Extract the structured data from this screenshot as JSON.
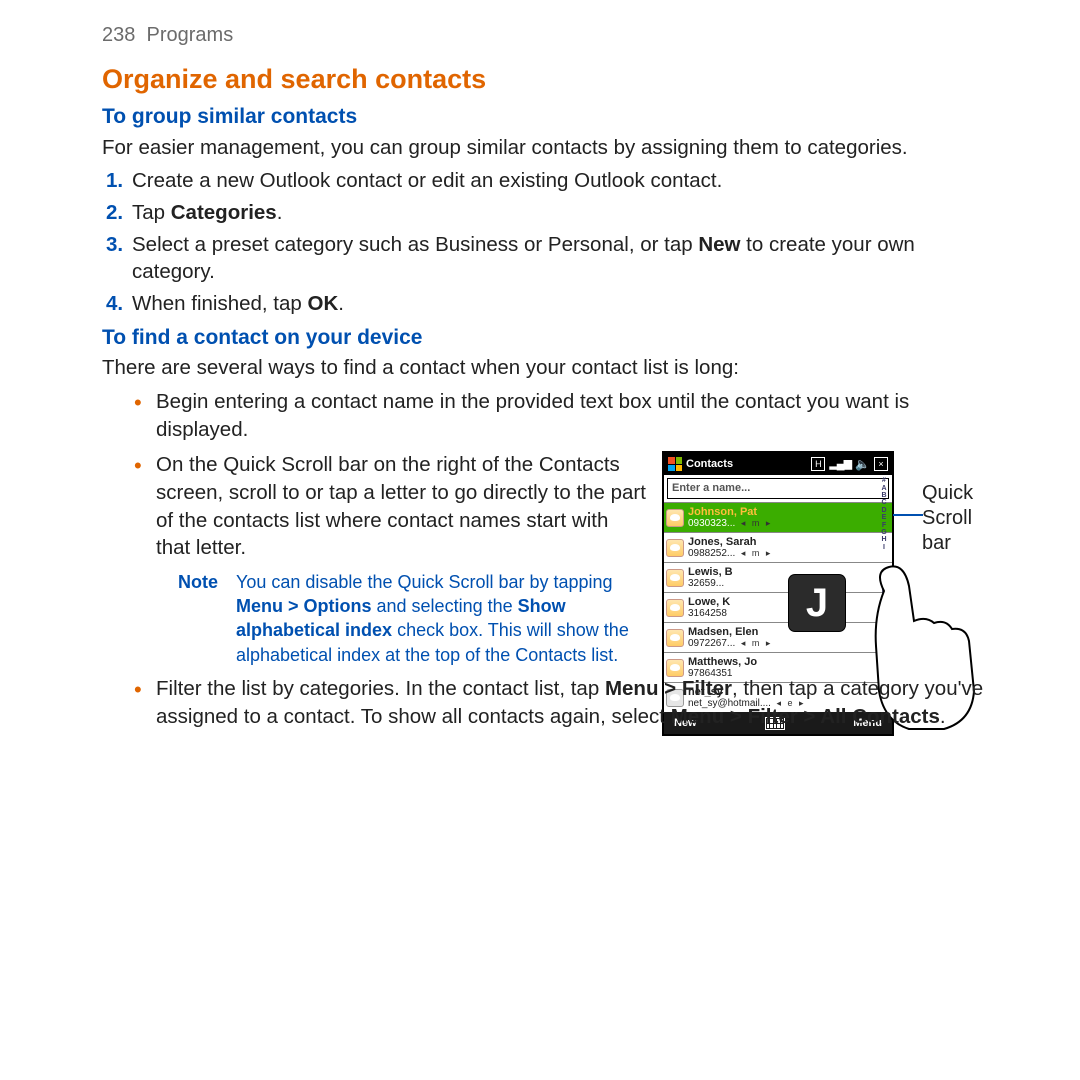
{
  "header": {
    "page_num": "238",
    "section": "Programs"
  },
  "title": "Organize and search contacts",
  "sub1": "To group similar contacts",
  "para1": "For easier management, you can group similar contacts by assigning them to categories.",
  "steps": [
    "Create a new Outlook contact or edit an existing Outlook contact.",
    {
      "pre": "Tap ",
      "b": "Categories",
      "post": "."
    },
    {
      "pre": "Select a preset category such as Business or Personal, or tap ",
      "b": "New",
      "post": " to create your own category."
    },
    {
      "pre": "When finished, tap ",
      "b": "OK",
      "post": "."
    }
  ],
  "sub2": "To find a contact on your device",
  "para2": "There are several ways to find a contact when your contact list is long:",
  "bullets": {
    "b1": "Begin entering a contact name in the provided text box until the contact you want is displayed.",
    "b2": "On the Quick Scroll bar on the right of the Contacts screen, scroll to or tap a letter to go directly to the part of the contacts list where contact names start with that letter.",
    "note": {
      "label": "Note",
      "t1": "You can disable the Quick Scroll bar by tapping ",
      "b1": "Menu > Options",
      "t2": " and selecting the ",
      "b2": "Show alphabetical index",
      "t3": " check box. This will show the alphabetical index at the top of the Contacts list."
    },
    "b3": {
      "t1": "Filter the list by categories. In the contact list, tap ",
      "b1": "Menu > Filter",
      "t2": ", then tap a category you've assigned to a contact. To show all contacts again, select ",
      "b2": "Menu > Filter > All Contacts",
      "t3": "."
    }
  },
  "figure": {
    "titlebar": "Contacts",
    "status_h": "H",
    "status_x": "×",
    "search_placeholder": "Enter a name...",
    "contacts": [
      {
        "name": "Johnson, Pat",
        "sub": "0930323...",
        "arr": "◂ m ▸",
        "sel": true
      },
      {
        "name": "Jones, Sarah",
        "sub": "0988252...",
        "arr": "◂ m ▸"
      },
      {
        "name": "Lewis, B",
        "sub": "32659...",
        "arr": ""
      },
      {
        "name": "Lowe, K",
        "sub": "3164258",
        "arr": ""
      },
      {
        "name": "Madsen, Elen",
        "sub": "0972267...",
        "arr": "◂ m ▸"
      },
      {
        "name": "Matthews, Jo",
        "sub": "97864351",
        "arr": ""
      },
      {
        "name": "net_sy",
        "sub": "net_sy@hotmail....",
        "arr": "◂ e ▸",
        "last": true
      }
    ],
    "popup_letter": "J",
    "soft_left": "New",
    "soft_right": "Menu",
    "alpha": "# A B C D E F G H I . . . P Q R S T U V W X Y Z",
    "callout": "Quick Scroll bar"
  }
}
